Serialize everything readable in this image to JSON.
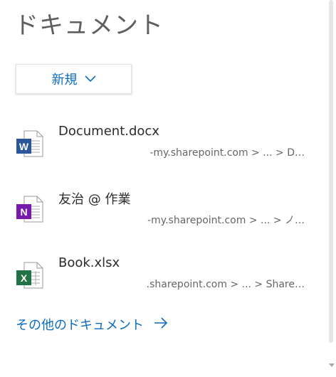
{
  "header": {
    "title": "ドキュメント"
  },
  "new_button": {
    "label": "新規",
    "icon": "chevron-down-icon"
  },
  "documents": [
    {
      "name": "Document.docx",
      "path": "-my.sharepoint.com > ... > D…",
      "app": "word",
      "icon": "word-icon",
      "color": "#2b579a"
    },
    {
      "name": "友治 @ 作業",
      "path": "-my.sharepoint.com > ... > ノ…",
      "app": "onenote",
      "icon": "onenote-icon",
      "color": "#7719aa"
    },
    {
      "name": "Book.xlsx",
      "path": ".sharepoint.com > ... > Share…",
      "app": "excel",
      "icon": "excel-icon",
      "color": "#217346"
    }
  ],
  "footer": {
    "more_label": "その他のドキュメント",
    "arrow_icon": "arrow-right-icon"
  },
  "colors": {
    "accent": "#0f6cbd",
    "title": "#5e5e5e"
  }
}
